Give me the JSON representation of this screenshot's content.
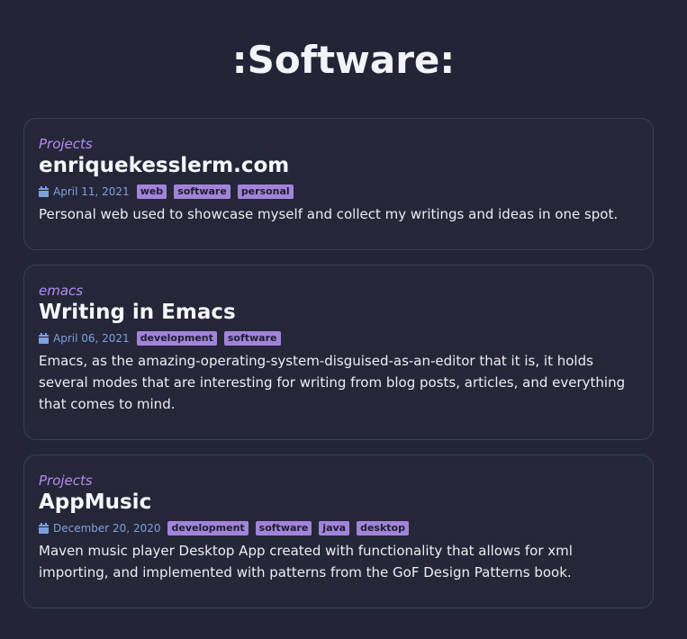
{
  "page": {
    "title": ":Software:"
  },
  "posts": [
    {
      "category": "Projects",
      "title": "enriquekesslerm.com",
      "date": "April 11, 2021",
      "tags": [
        "web",
        "software",
        "personal"
      ],
      "description": "Personal web used to showcase myself and collect my writings and ideas in one spot."
    },
    {
      "category": "emacs",
      "title": "Writing in Emacs",
      "date": "April 06, 2021",
      "tags": [
        "development",
        "software"
      ],
      "description": "Emacs, as the amazing-operating-system-disguised-as-an-editor that it is, it holds several modes that are interesting for writing from blog posts, articles, and everything that comes to mind."
    },
    {
      "category": "Projects",
      "title": "AppMusic",
      "date": "December 20, 2020",
      "tags": [
        "development",
        "software",
        "java",
        "desktop"
      ],
      "description": "Maven music player Desktop App created with functionality that allows for xml importing, and implemented with patterns from the GoF Design Patterns book."
    }
  ],
  "icons": {
    "date": "calendar-icon"
  },
  "colors": {
    "background": "#232537",
    "card": "#252739",
    "category": "#b48cf0",
    "date": "#7ba0de",
    "tag": "#a184d9"
  }
}
